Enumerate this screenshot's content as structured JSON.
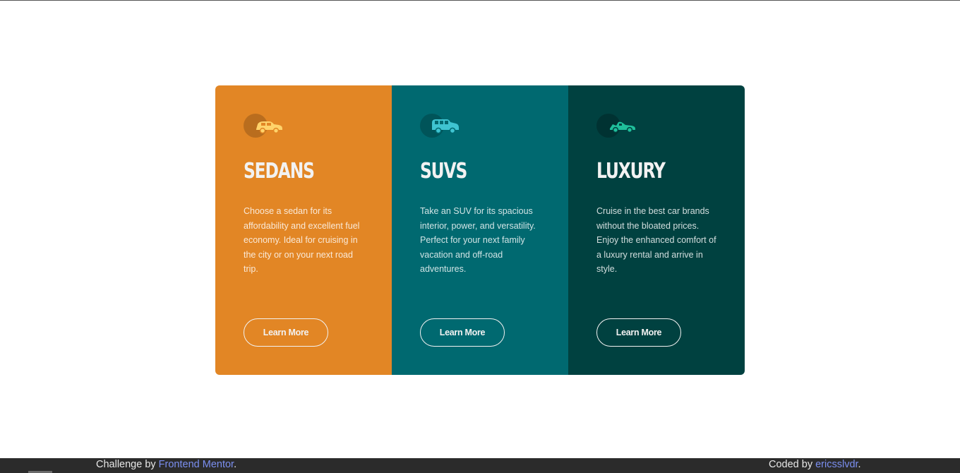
{
  "cards": [
    {
      "title": "SEDANS",
      "description": "Choose a sedan for its affordability and excellent fuel economy. Ideal for cruising in the city or on your next road trip.",
      "button_label": "Learn More",
      "icon": "sedan-car-icon",
      "background": "#e28625",
      "icon_color": "#ffd36b"
    },
    {
      "title": "SUVS",
      "description": "Take an SUV for its spacious interior, power, and versatility. Perfect for your next family vacation and off-road adventures.",
      "button_label": "Learn More",
      "icon": "suv-car-icon",
      "background": "#006970",
      "icon_color": "#3fc4d1"
    },
    {
      "title": "LUXURY",
      "description": "Cruise in the best car brands without the bloated prices. Enjoy the enhanced comfort of a luxury rental and arrive in style.",
      "button_label": "Learn More",
      "icon": "luxury-car-icon",
      "background": "#004140",
      "icon_color": "#1fbf9b"
    }
  ],
  "footer": {
    "challenge_prefix": "Challenge by ",
    "challenge_link": "Frontend Mentor",
    "challenge_suffix": ".",
    "coded_prefix": "Coded by ",
    "coded_link": "ericsslvdr",
    "coded_suffix": ".",
    "link_color": "#7b8ff0"
  }
}
